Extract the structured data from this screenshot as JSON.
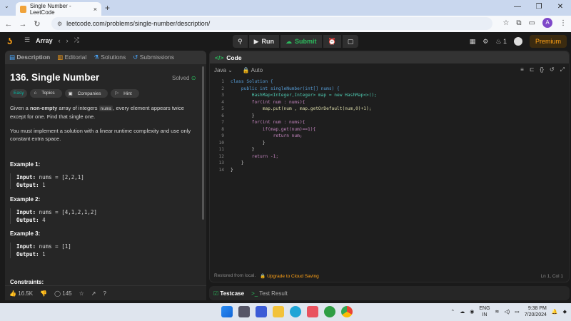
{
  "browser": {
    "tab_title": "Single Number - LeetCode",
    "tab_close": "×",
    "new_tab": "+",
    "url": "leetcode.com/problems/single-number/description/",
    "window_controls": [
      "—",
      "❐",
      "✕"
    ],
    "profile_letter": "A"
  },
  "nav": {
    "problem_list": "Array",
    "run_label": "Run",
    "submit_label": "Submit",
    "streak": "1",
    "premium_label": "Premium"
  },
  "left": {
    "tabs": [
      "Description",
      "Editorial",
      "Solutions",
      "Submissions"
    ],
    "title": "136. Single Number",
    "solved": "Solved",
    "tags": [
      "Easy",
      "Topics",
      "Companies",
      "Hint"
    ],
    "desc_p1_a": "Given a ",
    "desc_p1_b": "non-empty",
    "desc_p1_c": " array of integers ",
    "desc_p1_code": "nums",
    "desc_p1_d": ", every element appears twice except for one. Find that single one.",
    "desc_p2": "You must implement a solution with a linear runtime complexity and use only constant extra space.",
    "examples": [
      {
        "heading": "Example 1:",
        "input_label": "Input:",
        "input": "nums = [2,2,1]",
        "output_label": "Output:",
        "output": "1"
      },
      {
        "heading": "Example 2:",
        "input_label": "Input:",
        "input": "nums = [4,1,2,1,2]",
        "output_label": "Output:",
        "output": "4"
      },
      {
        "heading": "Example 3:",
        "input_label": "Input:",
        "input": "nums = [1]",
        "output_label": "Output:",
        "output": "1"
      }
    ],
    "constraints": "Constraints:",
    "likes": "16.5K",
    "comments": "145"
  },
  "code": {
    "header": "Code",
    "language": "Java",
    "mode": "Auto",
    "lines": [
      "class Solution {",
      "    public int singleNumber(int[] nums) {",
      "        HashMap<Integer,Integer> map = new HashMap<>();",
      "        for(int num : nums){",
      "            map.put(num , map.getOrDefault(num,0)+1);",
      "        }",
      "        for(int num : nums){",
      "            if(map.get(num)==1){",
      "                return num;",
      "            }",
      "        }",
      "        return -1;",
      "    }",
      "}"
    ],
    "line_numbers": [
      "1",
      "2",
      "3",
      "4",
      "5",
      "6",
      "7",
      "8",
      "9",
      "10",
      "11",
      "12",
      "13",
      "14"
    ],
    "restored": "Restored from local.",
    "upgrade": "Upgrade to Cloud Saving",
    "cursor": "Ln 1, Col 1"
  },
  "test": {
    "tab1": "Testcase",
    "tab2": "Test Result"
  },
  "taskbar": {
    "lang_1": "ENG",
    "lang_2": "IN",
    "time": "9:38 PM",
    "date": "7/20/2024"
  }
}
